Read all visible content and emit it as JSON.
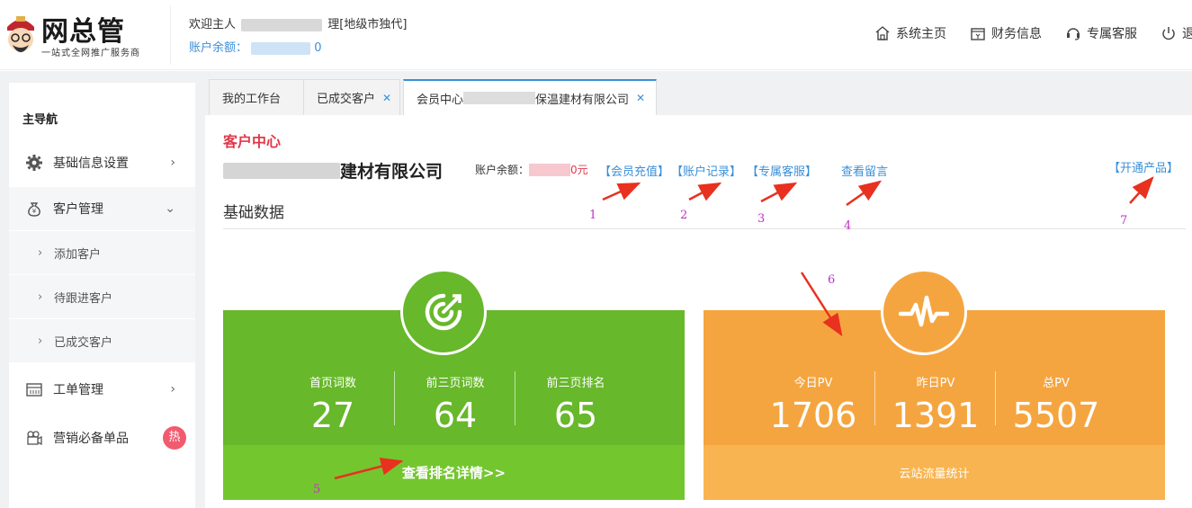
{
  "header": {
    "logo_title": "网总管",
    "logo_sub": "一站式全网推广服务商",
    "welcome_prefix": "欢迎主人",
    "welcome_suffix": "理[地级市独代]",
    "balance_label": "账户余额：",
    "balance_tail": "0",
    "nav": [
      "系统主页",
      "财务信息",
      "专属客服",
      "退"
    ]
  },
  "sidebar": {
    "title": "主导航",
    "items": [
      "基础信息设置",
      "客户管理",
      "工单管理",
      "营销必备单品"
    ],
    "sub_items": [
      "添加客户",
      "待跟进客户",
      "已成交客户"
    ],
    "hot_badge": "热"
  },
  "tabs": [
    {
      "label": "我的工作台",
      "closable": false
    },
    {
      "label": "已成交客户",
      "closable": true
    },
    {
      "label_prefix": "会员中心",
      "label_suffix": "保温建材有限公司",
      "closable": true
    }
  ],
  "main": {
    "section_title": "客户中心",
    "company_suffix": "建材有限公司",
    "account_label": "账户余额：",
    "account_unit": "0元",
    "links": [
      "【会员充值】",
      "【账户记录】",
      "【专属客服】",
      "查看留言",
      "【开通产品】"
    ],
    "base_title": "基础数据"
  },
  "cards": {
    "green": {
      "stats": [
        {
          "label": "首页词数",
          "value": "27"
        },
        {
          "label": "前三页词数",
          "value": "64"
        },
        {
          "label": "前三页排名",
          "value": "65"
        }
      ],
      "footer": "查看排名详情>>",
      "color_top": "#67b82a",
      "color_bot": "#74c62f"
    },
    "orange": {
      "stats": [
        {
          "label": "今日PV",
          "value": "1706"
        },
        {
          "label": "昨日PV",
          "value": "1391"
        },
        {
          "label": "总PV",
          "value": "5507"
        }
      ],
      "footer": "云站流量统计",
      "color_top": "#f5a53f",
      "color_bot": "#f8b451"
    }
  },
  "annotations": [
    "1",
    "2",
    "3",
    "4",
    "5",
    "6",
    "7"
  ],
  "colors": {
    "accent": "#3b8fd8",
    "red": "#e0394a",
    "annotation": "#c132c7"
  }
}
